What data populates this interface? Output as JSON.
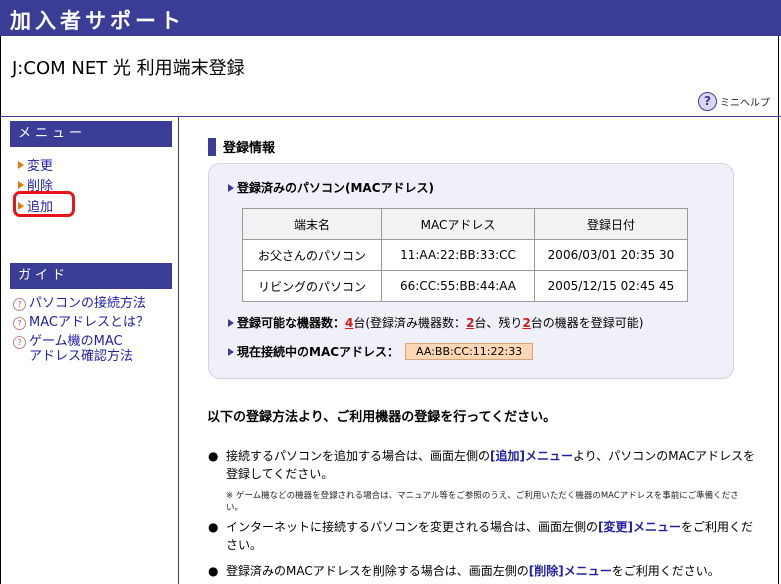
{
  "header": {
    "title": "加入者サポート"
  },
  "page": {
    "title": "J:COM NET 光 利用端末登録"
  },
  "help": {
    "label": "ミニヘルプ",
    "icon": "question-circle-icon"
  },
  "sidebar": {
    "menu_title": "メニュー",
    "menu_items": [
      {
        "label": "変更"
      },
      {
        "label": "削除"
      },
      {
        "label": "追加"
      }
    ],
    "guide_title": "ガイド",
    "guide_items": [
      {
        "label": "パソコンの接続方法"
      },
      {
        "label": "MACアドレスとは？"
      },
      {
        "label_line1": "ゲーム機のMAC",
        "label_line2": "アドレス確認方法"
      }
    ]
  },
  "main": {
    "section_title": "登録情報",
    "registered_heading": "登録済みのパソコン(MACアドレス)",
    "table": {
      "headers": [
        "端末名",
        "MACアドレス",
        "登録日付"
      ],
      "rows": [
        {
          "name": "お父さんのパソコン",
          "mac": "11:AA:22:BB:33:CC",
          "date": "2006/03/01 20:35 30"
        },
        {
          "name": "リビングのパソコン",
          "mac": "66:CC:55:BB:44:AA",
          "date": "2005/12/15 02:45 45"
        }
      ]
    },
    "capacity": {
      "label": "登録可能な機器数：",
      "total": "4",
      "text1": "台(登録済み機器数：",
      "registered": "2",
      "text2": "台、残り",
      "remaining": "2",
      "text3": "台の機器を登録可能)"
    },
    "current": {
      "label": "現在接続中のMACアドレス：",
      "mac": "AA:BB:CC:11:22:33"
    },
    "intro": "以下の登録方法より、ご利用機器の登録を行ってください。",
    "bullets": [
      {
        "pre": "接続するパソコンを追加する場合は、画面左側の",
        "link": "[追加]メニュー",
        "post": "より、パソコンのMACアドレスを登録してください。"
      },
      {
        "pre": "インターネットに接続するパソコンを変更される場合は、画面左側の",
        "link": "[変更]メニュー",
        "post": "をご利用ください。"
      },
      {
        "pre": "登録済みのMACアドレスを削除する場合は、画面左側の",
        "link": "[削除]メニュー",
        "post": "をご利用ください。"
      }
    ],
    "note": "※ ゲーム機などの機器を登録される場合は、マニュアル等をご参照のうえ、ご利用いただく機器のMACアドレスを事前にご準備ください。"
  },
  "colors": {
    "header_bg": "#3b3c96",
    "highlight": "#e8141c",
    "link": "#1f1fa8",
    "count": "#d11a1a",
    "mac_box": "#fbd7b4"
  }
}
